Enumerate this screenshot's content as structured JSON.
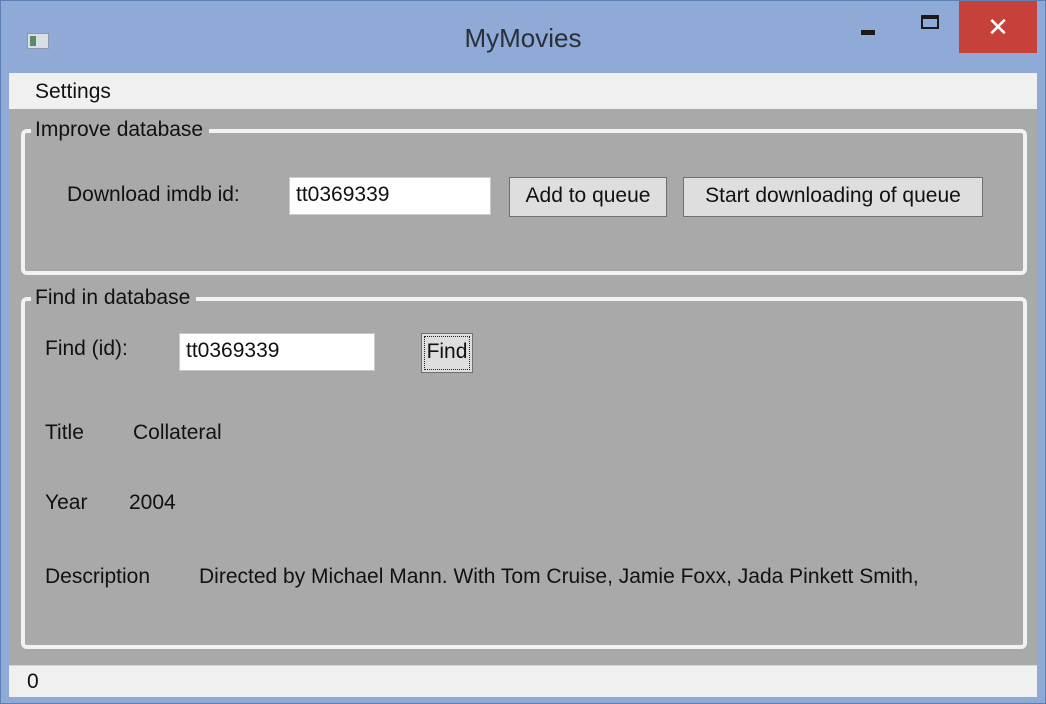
{
  "window": {
    "title": "MyMovies",
    "close_glyph": "✕"
  },
  "menu": {
    "items": [
      "Settings"
    ]
  },
  "improve": {
    "legend": "Improve database",
    "download_label": "Download imdb id:",
    "download_value": "tt0369339",
    "add_button": "Add to queue",
    "start_button": "Start downloading of queue"
  },
  "find": {
    "legend": "Find in database",
    "find_label": "Find (id):",
    "find_value": "tt0369339",
    "find_button": "Find",
    "title_label": "Title",
    "title_value": "Collateral",
    "year_label": "Year",
    "year_value": "2004",
    "description_label": "Description",
    "description_value": "Directed by Michael Mann.  With Tom Cruise, Jamie Foxx, Jada Pinkett Smith,"
  },
  "status": {
    "text": "0"
  },
  "icons": [
    "app-icon",
    "minimize-icon",
    "maximize-icon",
    "close-icon"
  ],
  "colors": {
    "titlebar": "#8faad6",
    "close": "#c7403a",
    "client": "#a9a9a9"
  }
}
